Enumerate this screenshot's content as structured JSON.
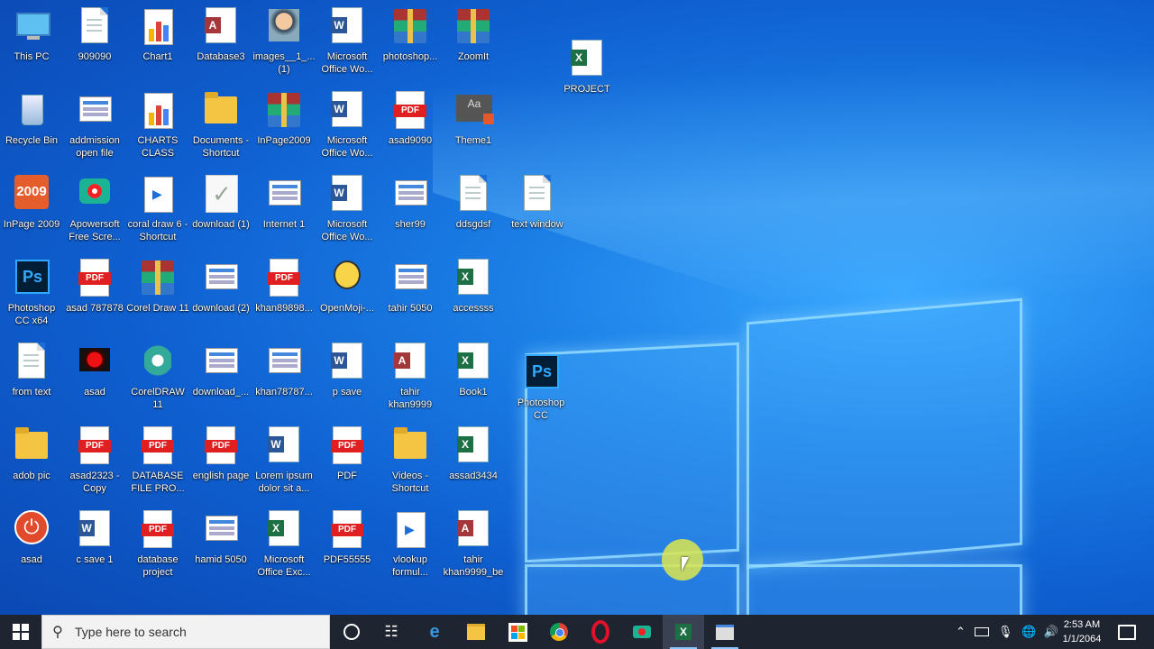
{
  "desktop": {
    "icons": [
      {
        "label": "This PC",
        "type": "pc"
      },
      {
        "label": "909090",
        "type": "doc"
      },
      {
        "label": "Chart1",
        "type": "chart"
      },
      {
        "label": "Database3",
        "type": "access"
      },
      {
        "label": "images__1_... (1)",
        "type": "photo"
      },
      {
        "label": "Microsoft Office Wo...",
        "type": "word"
      },
      {
        "label": "photoshop...",
        "type": "rar"
      },
      {
        "label": "ZoomIt",
        "type": "rar"
      },
      {
        "label": "Recycle Bin",
        "type": "bin"
      },
      {
        "label": "addmission open file",
        "type": "thumb"
      },
      {
        "label": "CHARTS CLASS",
        "type": "chart"
      },
      {
        "label": "Documents - Shortcut",
        "type": "folder"
      },
      {
        "label": "InPage2009",
        "type": "rar"
      },
      {
        "label": "Microsoft Office Wo...",
        "type": "word"
      },
      {
        "label": "asad9090",
        "type": "pdf"
      },
      {
        "label": "Theme1",
        "type": "theme"
      },
      {
        "label": "InPage 2009",
        "type": "app"
      },
      {
        "label": "Apowersoft Free Scre...",
        "type": "rec"
      },
      {
        "label": "coral draw 6 - Shortcut",
        "type": "video"
      },
      {
        "label": "download (1)",
        "type": "check"
      },
      {
        "label": "Internet 1",
        "type": "thumb"
      },
      {
        "label": "Microsoft Office Wo...",
        "type": "word"
      },
      {
        "label": "sher99",
        "type": "thumb"
      },
      {
        "label": "ddsgdsf",
        "type": "doc"
      },
      {
        "label": "text window",
        "type": "doc"
      },
      {
        "label": "Photoshop CC x64",
        "type": "ps"
      },
      {
        "label": "asad 787878",
        "type": "pdf"
      },
      {
        "label": "Corel Draw 11",
        "type": "rar"
      },
      {
        "label": "download (2)",
        "type": "thumb"
      },
      {
        "label": "khan89898...",
        "type": "pdf"
      },
      {
        "label": "OpenMoji-...",
        "type": "emoji"
      },
      {
        "label": "tahir 5050",
        "type": "thumb"
      },
      {
        "label": "accessss",
        "type": "excel"
      },
      {
        "label": "from text",
        "type": "doc"
      },
      {
        "label": "asad",
        "type": "red"
      },
      {
        "label": "CorelDRAW 11",
        "type": "coral"
      },
      {
        "label": "download_...",
        "type": "thumb"
      },
      {
        "label": "khan78787...",
        "type": "thumb"
      },
      {
        "label": "p save",
        "type": "word"
      },
      {
        "label": "tahir khan9999",
        "type": "access"
      },
      {
        "label": "Book1",
        "type": "excel"
      },
      {
        "label": "Photoshop CC",
        "type": "ps"
      },
      {
        "label": "adob pic",
        "type": "folder"
      },
      {
        "label": "asad2323 - Copy",
        "type": "pdf"
      },
      {
        "label": "DATABASE FILE PRO...",
        "type": "pdf"
      },
      {
        "label": "english page",
        "type": "pdf"
      },
      {
        "label": "Lorem ipsum dolor sit a...",
        "type": "word"
      },
      {
        "label": "PDF",
        "type": "pdf"
      },
      {
        "label": "Videos - Shortcut",
        "type": "folder"
      },
      {
        "label": "assad3434",
        "type": "excel"
      },
      {
        "label": "asad",
        "type": "power"
      },
      {
        "label": "c save 1",
        "type": "word"
      },
      {
        "label": "database project",
        "type": "pdf"
      },
      {
        "label": "hamid 5050",
        "type": "thumb"
      },
      {
        "label": "Microsoft Office Exc...",
        "type": "excel"
      },
      {
        "label": "PDF55555",
        "type": "pdf"
      },
      {
        "label": "vlookup formul...",
        "type": "video"
      },
      {
        "label": "tahir khan9999_be",
        "type": "access"
      },
      {
        "label": "PROJECT",
        "type": "excel"
      }
    ]
  },
  "taskbar": {
    "start_icon": "windows-logo",
    "search_placeholder": "Type here to search",
    "apps": [
      "cortana",
      "task-view",
      "edge",
      "file-explorer",
      "store",
      "chrome",
      "opera",
      "camera",
      "excel",
      "window"
    ],
    "tray_time": "2:53 AM",
    "tray_date": "1/1/2064"
  }
}
